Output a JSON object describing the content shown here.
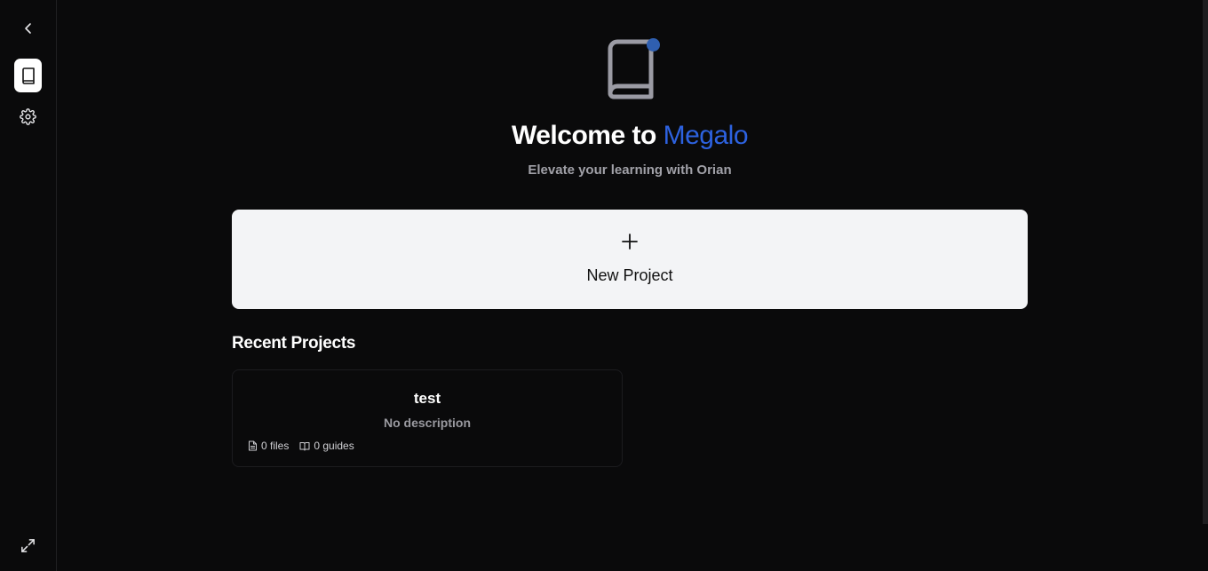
{
  "sidebar": {
    "collapse_icon": "chevron-left-icon",
    "projects_icon": "book-icon",
    "settings_icon": "gear-icon",
    "expand_icon": "expand-icon"
  },
  "hero": {
    "icon": "book-icon",
    "notification_dot_color": "#2f5fb0",
    "welcome_prefix": "Welcome to ",
    "brand": "Megalo",
    "brand_color": "#2d62e0",
    "subtitle": "Elevate your learning with Orian"
  },
  "new_project": {
    "icon": "plus-icon",
    "label": "New Project"
  },
  "recent": {
    "title": "Recent Projects",
    "projects": [
      {
        "name": "test",
        "description": "No description",
        "files": "0 files",
        "guides": "0 guides"
      }
    ]
  }
}
